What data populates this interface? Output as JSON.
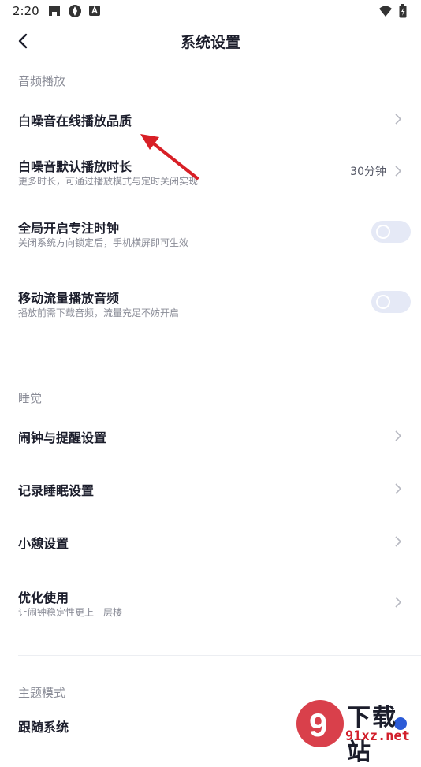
{
  "status_bar": {
    "time": "2:20"
  },
  "header": {
    "title": "系统设置"
  },
  "sections": [
    {
      "header": "音频播放",
      "items": [
        {
          "title": "白噪音在线播放品质",
          "subtitle": "",
          "value": ""
        },
        {
          "title": "白噪音默认播放时长",
          "subtitle": "更多时长，可通过播放模式与定时关闭实现",
          "value": "30分钟"
        },
        {
          "title": "全局开启专注时钟",
          "subtitle": "关闭系统方向锁定后，手机横屏即可生效",
          "value": ""
        },
        {
          "title": "移动流量播放音频",
          "subtitle": "播放前需下载音频，流量充足不妨开启",
          "value": ""
        }
      ]
    },
    {
      "header": "睡觉",
      "items": [
        {
          "title": "闹钟与提醒设置",
          "subtitle": ""
        },
        {
          "title": "记录睡眠设置",
          "subtitle": ""
        },
        {
          "title": "小憩设置",
          "subtitle": ""
        },
        {
          "title": "优化使用",
          "subtitle": "让闹钟稳定性更上一层楼"
        }
      ]
    },
    {
      "header": "主题模式",
      "items": [
        {
          "title": "跟随系统"
        }
      ]
    }
  ],
  "toggles": {
    "focus_clock_on": false,
    "mobile_data_on": false
  },
  "watermark": {
    "top": "下载站",
    "bottom": "91xz.net",
    "logo": "9"
  },
  "colors": {
    "accent": "#d21f2b",
    "toggle_off": "#e5e9f6",
    "muted_text": "#8a8c97"
  }
}
